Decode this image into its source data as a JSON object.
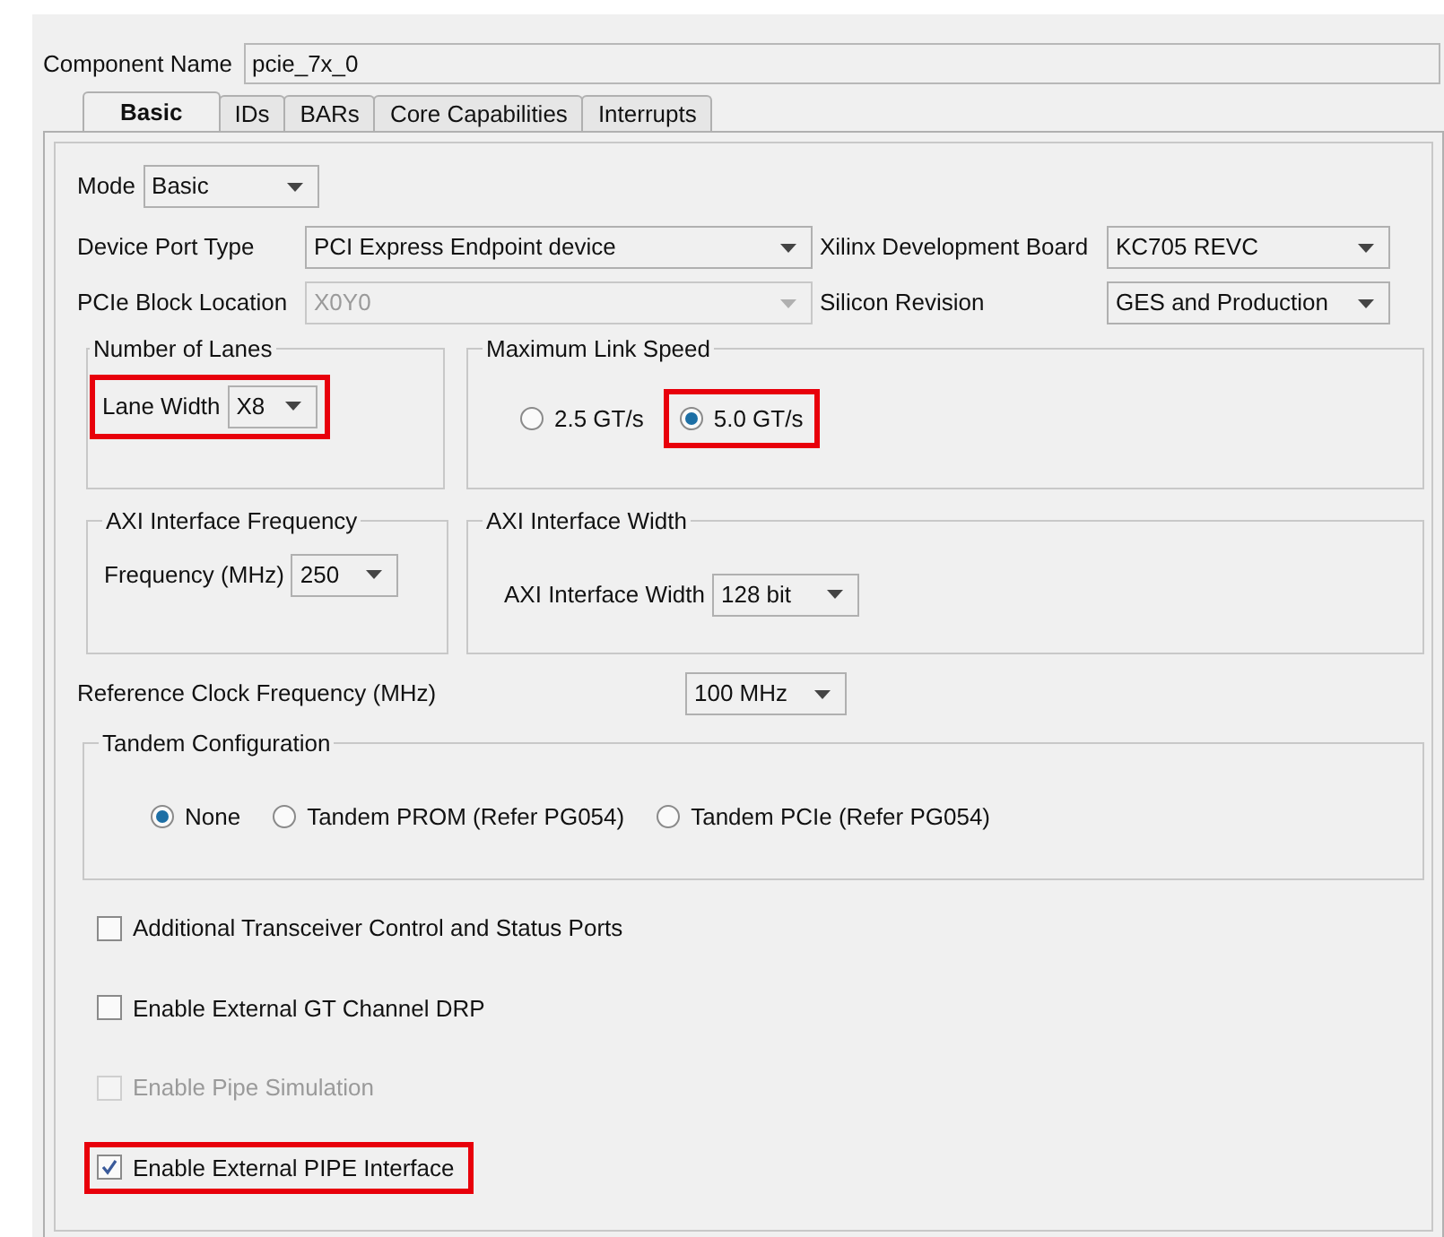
{
  "component_name": {
    "label": "Component Name",
    "value": "pcie_7x_0"
  },
  "tabs": [
    {
      "label": "Basic",
      "selected": true
    },
    {
      "label": "IDs",
      "selected": false
    },
    {
      "label": "BARs",
      "selected": false
    },
    {
      "label": "Core Capabilities",
      "selected": false
    },
    {
      "label": "Interrupts",
      "selected": false
    }
  ],
  "mode": {
    "label": "Mode",
    "value": "Basic"
  },
  "device_fields": [
    {
      "label": "Device Port Type",
      "value": "PCI Express Endpoint device",
      "disabled": false
    },
    {
      "label": "Xilinx Development Board",
      "value": "KC705 REVC",
      "disabled": false
    },
    {
      "label": "PCIe Block Location",
      "value": "X0Y0",
      "disabled": true
    },
    {
      "label": "Silicon Revision",
      "value": "GES and Production",
      "disabled": false
    }
  ],
  "number_of_lanes": {
    "title": "Number of Lanes",
    "label": "Lane Width",
    "value": "X8",
    "highlighted": true
  },
  "maximum_link_speed": {
    "title": "Maximum Link Speed",
    "options": [
      {
        "label": "2.5 GT/s",
        "selected": false,
        "highlighted": false
      },
      {
        "label": "5.0 GT/s",
        "selected": true,
        "highlighted": true
      }
    ]
  },
  "axi_interface_frequency": {
    "title": "AXI Interface Frequency",
    "label": "Frequency (MHz)",
    "value": "250"
  },
  "axi_interface_width": {
    "title": "AXI Interface Width",
    "label": "AXI Interface Width",
    "value": "128 bit"
  },
  "reference_clock": {
    "label": "Reference Clock Frequency (MHz)",
    "value": "100 MHz"
  },
  "tandem_configuration": {
    "title": "Tandem Configuration",
    "options": [
      {
        "label": "None",
        "selected": true
      },
      {
        "label": "Tandem PROM (Refer PG054)",
        "selected": false
      },
      {
        "label": "Tandem PCIe (Refer PG054)",
        "selected": false
      }
    ]
  },
  "checkboxes": [
    {
      "label": "Additional Transceiver Control and Status Ports",
      "checked": false,
      "disabled": false,
      "highlighted": false
    },
    {
      "label": "Enable External GT Channel DRP",
      "checked": false,
      "disabled": false,
      "highlighted": false
    },
    {
      "label": "Enable Pipe Simulation",
      "checked": false,
      "disabled": true,
      "highlighted": false
    },
    {
      "label": "Enable External PIPE Interface",
      "checked": true,
      "disabled": false,
      "highlighted": true
    }
  ]
}
